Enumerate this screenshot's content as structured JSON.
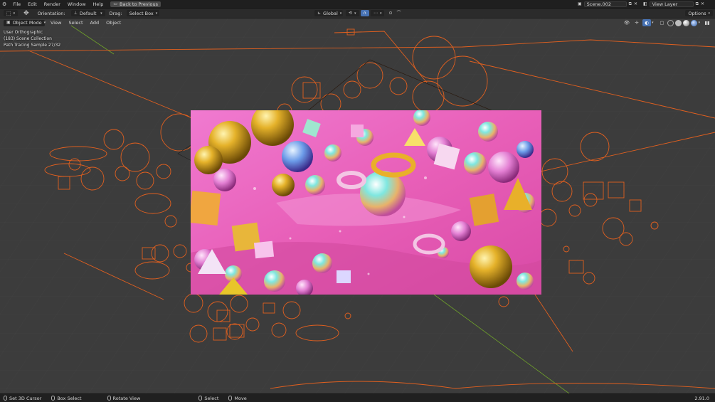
{
  "topbar": {
    "menus": [
      "File",
      "Edit",
      "Render",
      "Window",
      "Help"
    ],
    "back_button": "Back to Previous",
    "scene_name": "Scene.002",
    "view_layer": "View Layer"
  },
  "toolbar": {
    "orientation_label": "Orientation:",
    "orientation_value": "Default",
    "drag_label": "Drag:",
    "drag_value": "Select Box",
    "transform_space": "Global",
    "options_label": "Options"
  },
  "viewport_header": {
    "mode": "Object Mode",
    "menus": [
      "View",
      "Select",
      "Add",
      "Object"
    ]
  },
  "viewport_overlay": {
    "view_name": "User Orthographic",
    "collection": "(183) Scene Collection",
    "render_status": "Path Tracing Sample 27/32"
  },
  "statusbar": {
    "items": [
      {
        "icon": "mouse-left-icon",
        "label": "Set 3D Cursor"
      },
      {
        "icon": "mouse-left-icon",
        "label": "Box Select"
      },
      {
        "icon": "mouse-middle-icon",
        "label": "Rotate View"
      },
      {
        "icon": "mouse-left-icon",
        "label": "Select"
      },
      {
        "icon": "mouse-middle-icon",
        "label": "Move"
      }
    ],
    "version": "2.91.0"
  },
  "colors": {
    "accent_orange": "#e2601f",
    "viewport_bg": "#3c3c3c",
    "header_bg": "#1f1f1f",
    "active_blue": "#4772b3",
    "axis_green": "#6fa22a",
    "render_pink": "#e84fb0"
  }
}
